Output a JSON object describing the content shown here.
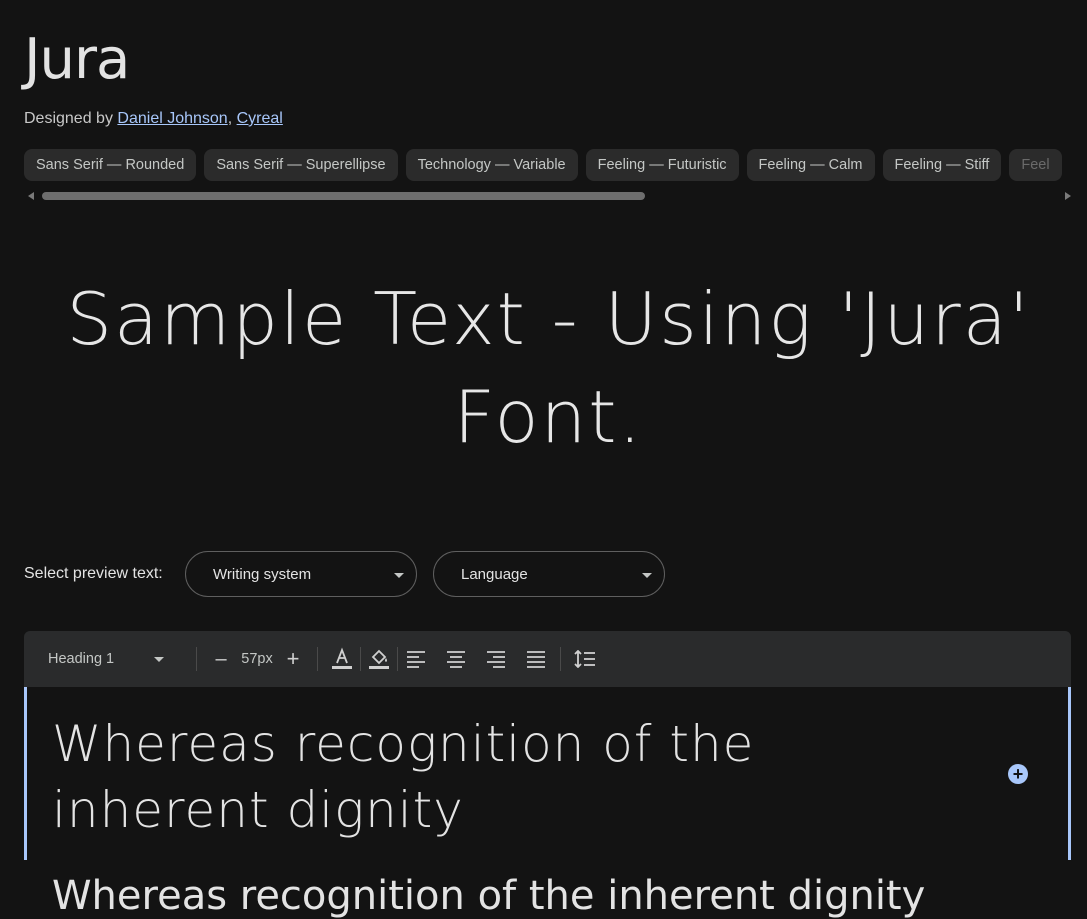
{
  "font": {
    "name": "Jura",
    "designed_by_label": "Designed by",
    "designers": [
      "Daniel Johnson",
      "Cyreal"
    ],
    "designer_separator": ","
  },
  "tags": [
    "Sans Serif — Rounded",
    "Sans Serif — Superellipse",
    "Technology — Variable",
    "Feeling — Futuristic",
    "Feeling — Calm",
    "Feeling — Stiff",
    "Feel"
  ],
  "sample_text": "Sample Text - Using 'Jura' Font.",
  "preview": {
    "label": "Select preview text:",
    "writing_system": "Writing system",
    "language": "Language"
  },
  "toolbar": {
    "style": "Heading 1",
    "size_decrease": "–",
    "size_value": "57px",
    "size_increase": "+",
    "icons": [
      "text-color-icon",
      "fill-color-icon",
      "align-left-icon",
      "align-center-icon",
      "align-right-icon",
      "align-justify-icon",
      "line-height-icon"
    ]
  },
  "editor": {
    "text": "Whereas recognition of the inherent dignity",
    "next_line": "Whereas recognition of the inherent dignity"
  },
  "colors": {
    "background": "#131313",
    "accent": "#a8c7fa",
    "chip": "#2b2b2b",
    "toolbar": "#2a2b2c"
  }
}
